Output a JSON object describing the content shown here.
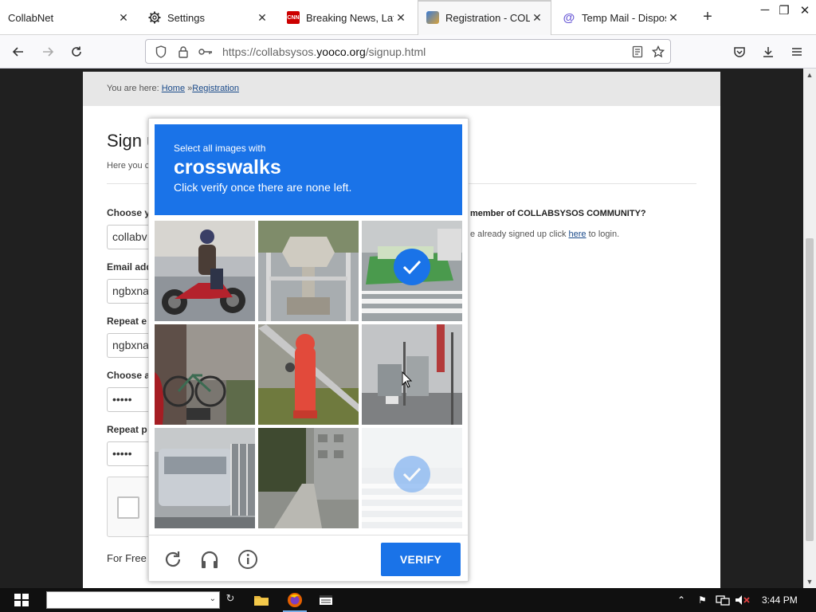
{
  "browser": {
    "tabs": [
      {
        "title": "CollabNet",
        "active": false,
        "favicon": "none"
      },
      {
        "title": "Settings",
        "active": false,
        "favicon": "gear-icon"
      },
      {
        "title": "Breaking News, Latest",
        "active": false,
        "favicon": "cnn-icon"
      },
      {
        "title": "Registration - COLLAB",
        "active": true,
        "favicon": "registration-icon"
      },
      {
        "title": "Temp Mail - Disposab",
        "active": false,
        "favicon": "at-icon"
      }
    ],
    "cnn_badge": "CNN",
    "url_prefix": "https://collabsysos.",
    "url_domain": "yooco.org",
    "url_path": "/signup.html"
  },
  "page": {
    "breadcrumb_prefix": "You are here:",
    "breadcrumb_home": "Home",
    "breadcrumb_sep": "»",
    "breadcrumb_current": "Registration",
    "title": "Sign u",
    "intro": "Here you c",
    "fields": [
      {
        "label": "Choose y",
        "value": "collabv"
      },
      {
        "label": "Email add",
        "value": "ngbxna"
      },
      {
        "label": "Repeat e",
        "value": "ngbxna"
      },
      {
        "label": "Choose a",
        "value": "•••••"
      },
      {
        "label": "Repeat p",
        "value": "•••••"
      }
    ],
    "for_free": "For Free",
    "member_heading": "member of COLLABSYSOS COMMUNITY?",
    "member_text_before": "e already signed up click",
    "member_link": "here",
    "member_text_after": "to login."
  },
  "captcha": {
    "instruction": "Select all images with",
    "keyword": "crosswalks",
    "note": "Click verify once there are none left.",
    "tiles": [
      {
        "subject": "motorcycle",
        "selected": false
      },
      {
        "subject": "fire-hydrant-post",
        "selected": false
      },
      {
        "subject": "taxi-crosswalk",
        "selected": true
      },
      {
        "subject": "bicycle",
        "selected": false
      },
      {
        "subject": "red-fire-hydrant",
        "selected": false
      },
      {
        "subject": "city-street",
        "selected": false
      },
      {
        "subject": "bus",
        "selected": false
      },
      {
        "subject": "sidewalk",
        "selected": false
      },
      {
        "subject": "crosswalk",
        "selected": true,
        "fading": true
      }
    ],
    "verify_label": "VERIFY"
  },
  "taskbar": {
    "time": "3:44 PM"
  },
  "colors": {
    "captcha_blue": "#1a73e8",
    "link": "#1a4a8a"
  }
}
